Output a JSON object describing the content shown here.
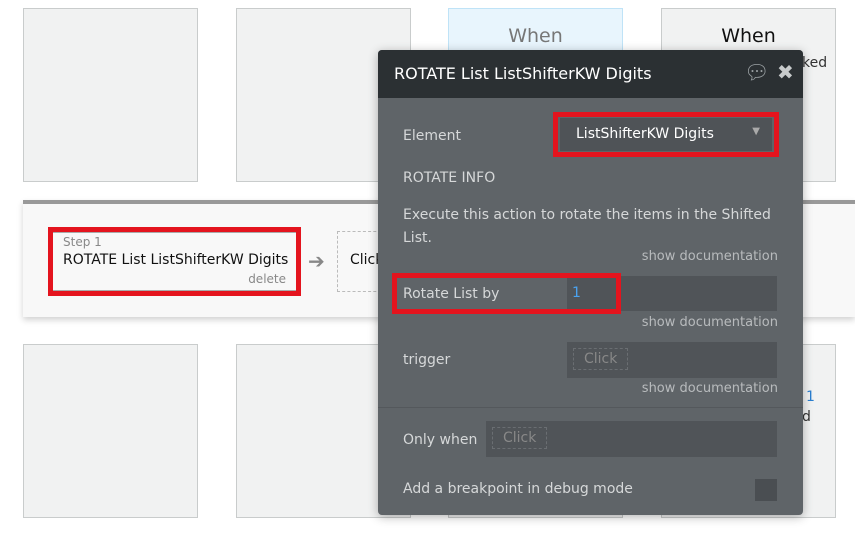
{
  "cards_top": [
    {
      "text": ""
    },
    {
      "text": ""
    },
    {
      "text": "When"
    },
    {
      "text": "When",
      "sub": "ked"
    }
  ],
  "cards_bottom_right": {
    "line1": "1",
    "line2": "d"
  },
  "step": {
    "label": "Step 1",
    "name": "ROTATE List ListShifterKW Digits",
    "delete": "delete"
  },
  "next_action": "Click",
  "panel": {
    "title": "ROTATE List ListShifterKW Digits",
    "element_label": "Element",
    "element_value": "ListShifterKW Digits",
    "section": "ROTATE INFO",
    "description": "Execute this action to rotate the items in the Shifted List.",
    "show_doc": "show documentation",
    "rotate_label": "Rotate List by",
    "rotate_value": "1",
    "trigger_label": "trigger",
    "trigger_placeholder": "Click",
    "only_when_label": "Only when",
    "only_when_placeholder": "Click",
    "breakpoint_label": "Add a breakpoint in debug mode"
  },
  "colors": {
    "highlight": "#e4141e",
    "header": "#2b3033",
    "panel": "#5f6468",
    "value": "#4aa3f0"
  }
}
